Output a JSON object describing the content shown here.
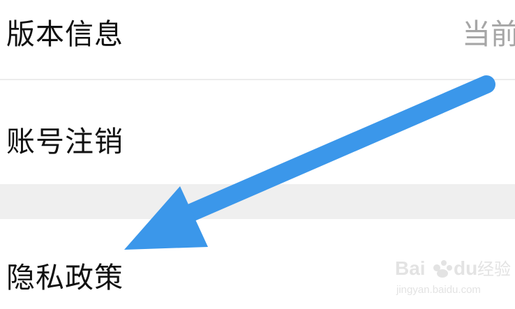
{
  "settings": {
    "version_info": {
      "label": "版本信息",
      "value": "当前"
    },
    "account_cancel": {
      "label": "账号注销"
    },
    "privacy_policy": {
      "label": "隐私政策"
    }
  },
  "annotation": {
    "arrow_color": "#3b97ea",
    "arrow_icon": "pointer-arrow-icon"
  },
  "watermark": {
    "brand": "Bai du 经验",
    "url": "jingyan.baidu.com"
  }
}
